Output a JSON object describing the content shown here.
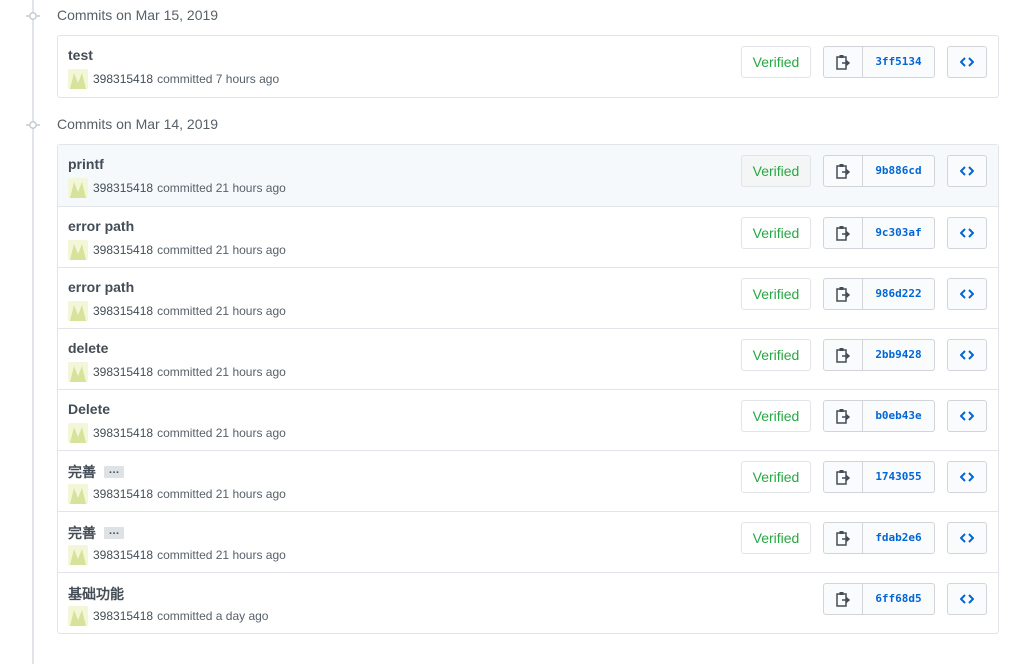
{
  "colors": {
    "verified": "#28a745",
    "sha": "#0366d6",
    "border": "#e1e4e8"
  },
  "groups": [
    {
      "title": "Commits on Mar 15, 2019",
      "commits": [
        {
          "message": "test",
          "has_more": false,
          "author": "398315418",
          "time": "committed 7 hours ago",
          "verified": "Verified",
          "sha": "3ff5134"
        }
      ]
    },
    {
      "title": "Commits on Mar 14, 2019",
      "commits": [
        {
          "message": "printf",
          "has_more": false,
          "author": "398315418",
          "time": "committed 21 hours ago",
          "verified": "Verified",
          "sha": "9b886cd"
        },
        {
          "message": "error path",
          "has_more": false,
          "author": "398315418",
          "time": "committed 21 hours ago",
          "verified": "Verified",
          "sha": "9c303af"
        },
        {
          "message": "error path",
          "has_more": false,
          "author": "398315418",
          "time": "committed 21 hours ago",
          "verified": "Verified",
          "sha": "986d222"
        },
        {
          "message": "delete",
          "has_more": false,
          "author": "398315418",
          "time": "committed 21 hours ago",
          "verified": "Verified",
          "sha": "2bb9428"
        },
        {
          "message": "Delete",
          "has_more": false,
          "author": "398315418",
          "time": "committed 21 hours ago",
          "verified": "Verified",
          "sha": "b0eb43e"
        },
        {
          "message": "完善",
          "has_more": true,
          "more_label": "…",
          "author": "398315418",
          "time": "committed 21 hours ago",
          "verified": "Verified",
          "sha": "1743055"
        },
        {
          "message": "完善",
          "has_more": true,
          "more_label": "…",
          "author": "398315418",
          "time": "committed 21 hours ago",
          "verified": "Verified",
          "sha": "fdab2e6"
        },
        {
          "message": "基础功能",
          "has_more": false,
          "author": "398315418",
          "time": "committed a day ago",
          "verified": "",
          "sha": "6ff68d5"
        }
      ]
    }
  ]
}
